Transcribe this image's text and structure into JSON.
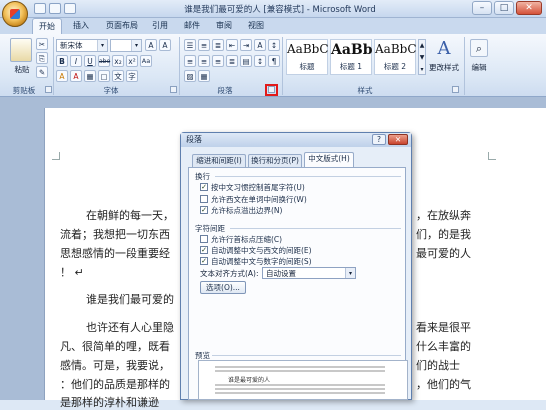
{
  "window": {
    "title": "谁是我们最可爱的人 [兼容模式] - Microsoft Word",
    "minimize": "–",
    "maximize": "□",
    "close": "✕"
  },
  "tabs": [
    "开始",
    "插入",
    "页面布局",
    "引用",
    "邮件",
    "审阅",
    "视图"
  ],
  "ribbon": {
    "clipboard": {
      "paste_label": "粘贴",
      "group_label": "剪贴板"
    },
    "font": {
      "font_name": "新宋体",
      "font_size": "",
      "group_label": "字体",
      "buttons": [
        "B",
        "I",
        "U",
        "abe",
        "x₂",
        "x²",
        "Aa",
        "A",
        "A",
        "A",
        "A"
      ]
    },
    "paragraph": {
      "group_label": "段落"
    },
    "styles": {
      "items": [
        {
          "sample": "AaBbC",
          "label": "标题"
        },
        {
          "sample": "AaBb",
          "label": "标题 1"
        },
        {
          "sample": "AaBbC",
          "label": "标题 2"
        }
      ],
      "change_styles_label": "更改样式",
      "group_label": "样式"
    },
    "editing": {
      "label": "编辑"
    }
  },
  "document": {
    "lines": [
      "在朝鲜的每一天，",
      "流着；我想把一切东西",
      "思想感情的一段重要经",
      "！ ↵",
      "谁是我们最可爱的",
      "也许还有人心里隐",
      "凡、很简单的哩，既看",
      "感情。可是，我要说，",
      "：他们的品质是那样的",
      "是那样的淳朴和谦逊"
    ],
    "right_fragments": [
      "，在放纵奔",
      "们，的是我",
      "最可爱的人",
      "看来是很平",
      "什么丰富的",
      "们的战士",
      "，他们的气"
    ]
  },
  "dialog": {
    "title": "段落",
    "help": "?",
    "close": "✕",
    "tabs": [
      "缩进和间距(I)",
      "换行和分页(P)",
      "中文版式(H)"
    ],
    "sections": {
      "line_break": {
        "title": "换行",
        "options": [
          {
            "label": "按中文习惯控制首尾字符(U)",
            "checked": true
          },
          {
            "label": "允许西文在单词中间换行(W)",
            "checked": false
          },
          {
            "label": "允许标点溢出边界(N)",
            "checked": true
          }
        ]
      },
      "char_spacing": {
        "title": "字符间距",
        "options": [
          {
            "label": "允许行首标点压缩(C)",
            "checked": false
          },
          {
            "label": "自动调整中文与西文的间距(E)",
            "checked": true
          },
          {
            "label": "自动调整中文与数字的间距(S)",
            "checked": true
          }
        ],
        "align_label": "文本对齐方式(A):",
        "align_value": "自动设置",
        "options_button": "选项(O)..."
      },
      "preview": {
        "title": "预览",
        "sample_text": "谁是最可爱的人"
      }
    }
  },
  "colors": {
    "highlight": "#e21a1a",
    "ribbon_bg": "#dbe7f5",
    "page": "#ffffff"
  }
}
